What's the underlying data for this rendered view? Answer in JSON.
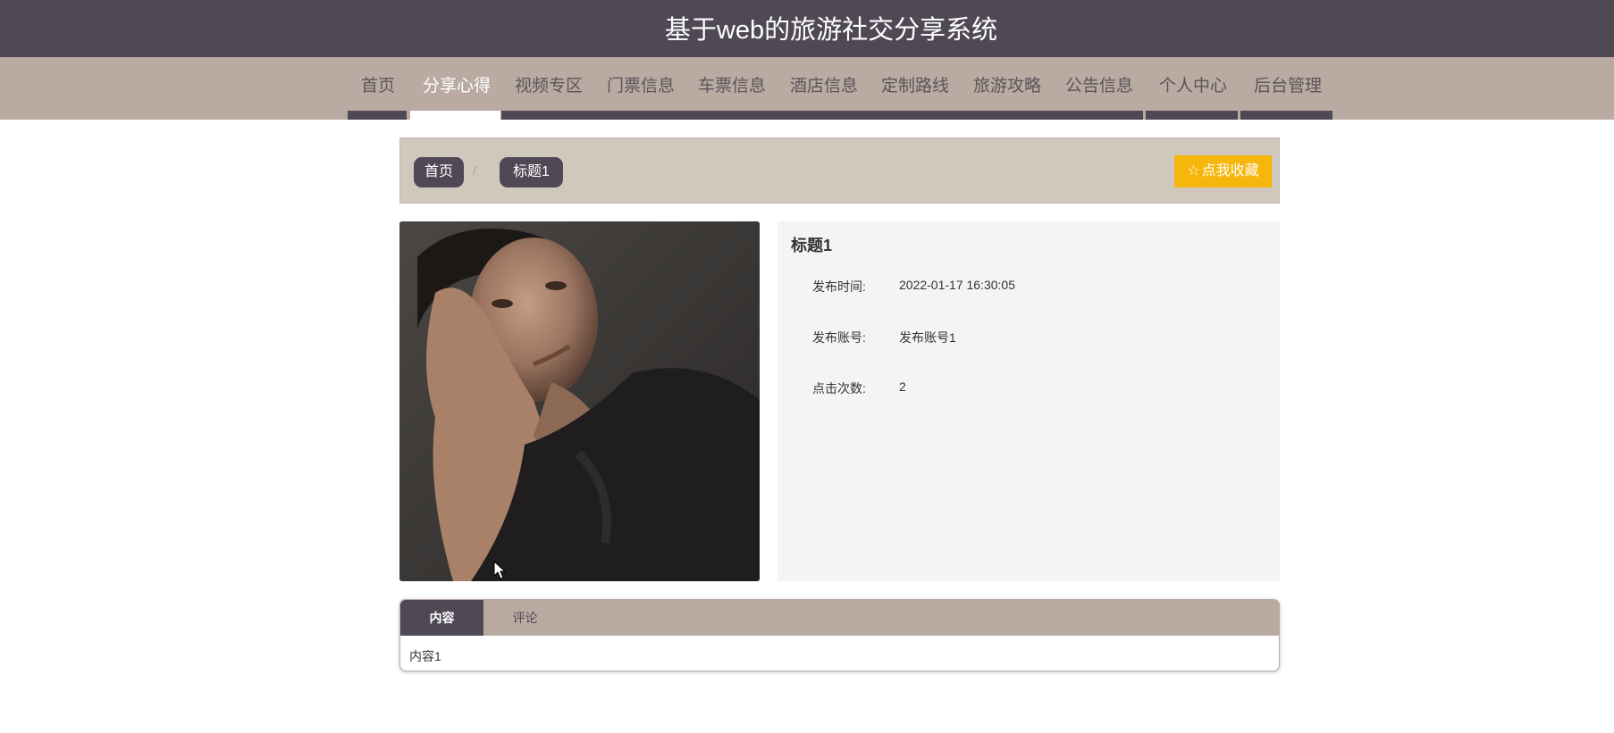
{
  "site": {
    "title": "基于web的旅游社交分享系统"
  },
  "nav": {
    "items": [
      {
        "label": "首页"
      },
      {
        "label": "分享心得"
      },
      {
        "label": "视频专区"
      },
      {
        "label": "门票信息"
      },
      {
        "label": "车票信息"
      },
      {
        "label": "酒店信息"
      },
      {
        "label": "定制路线"
      },
      {
        "label": "旅游攻略"
      },
      {
        "label": "公告信息"
      },
      {
        "label": "个人中心"
      },
      {
        "label": "后台管理"
      }
    ],
    "active_index": 1
  },
  "breadcrumb": {
    "home": "首页",
    "separator": "/",
    "current": "标题1"
  },
  "favorite_button": {
    "label": "点我收藏",
    "icon": "star-outline-icon"
  },
  "detail": {
    "title": "标题1",
    "rows": [
      {
        "label": "发布时间:",
        "value": "2022-01-17 16:30:05"
      },
      {
        "label": "发布账号:",
        "value": "发布账号1"
      },
      {
        "label": "点击次数:",
        "value": "2"
      }
    ]
  },
  "tabs": {
    "items": [
      {
        "label": "内容"
      },
      {
        "label": "评论"
      }
    ],
    "active_index": 0,
    "content": "内容1"
  },
  "colors": {
    "header_bg": "#4f4955",
    "nav_bg": "#b9aba2",
    "breadcrumb_bg": "#d0c7bd",
    "favorite_bg": "#f6b60b",
    "info_panel_bg": "#f4f4f4"
  }
}
